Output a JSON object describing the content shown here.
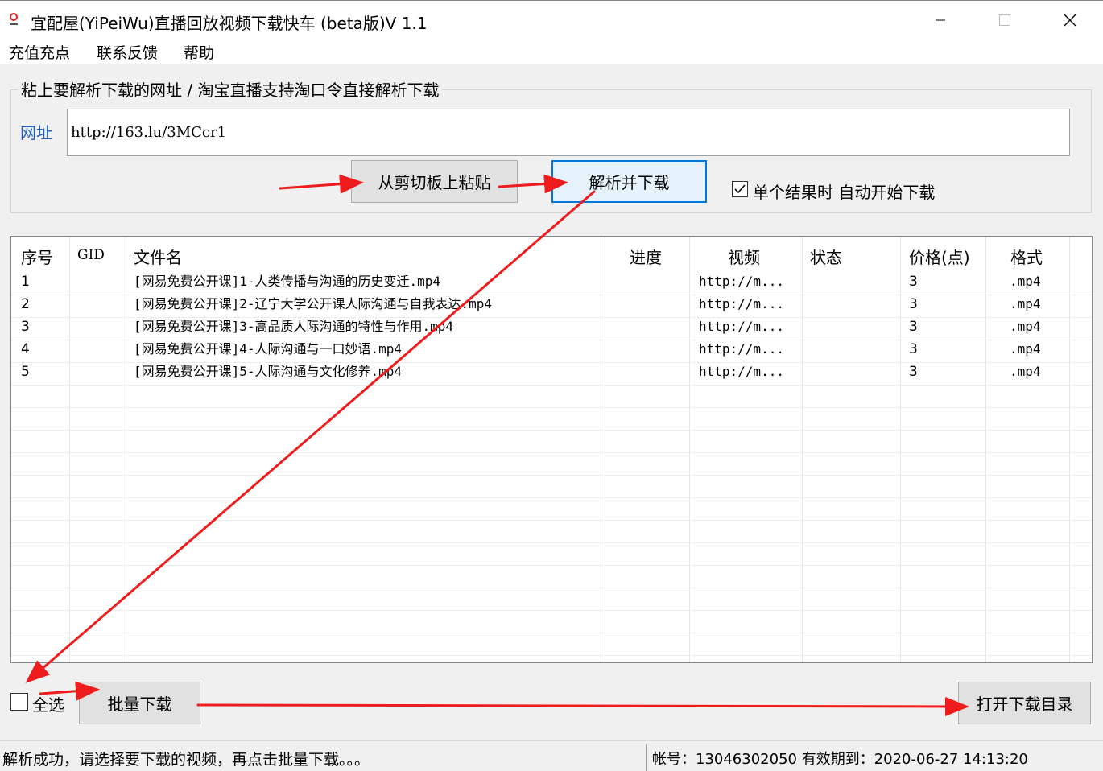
{
  "window": {
    "title": "宜配屋(YiPeiWu)直播回放视频下载快车 (beta版)V 1.1",
    "minimize_icon": "minimize-icon",
    "maximize_icon": "maximize-icon",
    "close_icon": "close-icon"
  },
  "menu": {
    "items": [
      "充值充点",
      "联系反馈",
      "帮助"
    ]
  },
  "input_group": {
    "legend": "粘上要解析下载的网址 / 淘宝直播支持淘口令直接解析下载",
    "url_label": "网址",
    "url_value": "http://163.lu/3MCcr1",
    "paste_button": "从剪切板上粘贴",
    "parse_button": "解析并下载",
    "auto_download_label": "单个结果时 自动开始下载",
    "auto_download_checked": true
  },
  "table": {
    "headers": [
      "序号",
      "GID",
      "文件名",
      "进度",
      "视频",
      "状态",
      "价格(点)",
      "格式"
    ],
    "rows": [
      {
        "index": "1",
        "gid": "",
        "filename": "[网易免费公开课]1-人类传播与沟通的历史变迁.mp4",
        "progress": "",
        "video": "http://m...",
        "status": "",
        "price": "3",
        "format": ".mp4"
      },
      {
        "index": "2",
        "gid": "",
        "filename": "[网易免费公开课]2-辽宁大学公开课人际沟通与自我表达.mp4",
        "progress": "",
        "video": "http://m...",
        "status": "",
        "price": "3",
        "format": ".mp4"
      },
      {
        "index": "3",
        "gid": "",
        "filename": "[网易免费公开课]3-高品质人际沟通的特性与作用.mp4",
        "progress": "",
        "video": "http://m...",
        "status": "",
        "price": "3",
        "format": ".mp4"
      },
      {
        "index": "4",
        "gid": "",
        "filename": "[网易免费公开课]4-人际沟通与一口妙语.mp4",
        "progress": "",
        "video": "http://m...",
        "status": "",
        "price": "3",
        "format": ".mp4"
      },
      {
        "index": "5",
        "gid": "",
        "filename": "[网易免费公开课]5-人际沟通与文化修养.mp4",
        "progress": "",
        "video": "http://m...",
        "status": "",
        "price": "3",
        "format": ".mp4"
      }
    ]
  },
  "bottom": {
    "select_all_label": "全选",
    "select_all_checked": false,
    "batch_download_button": "批量下载",
    "open_folder_button": "打开下载目录"
  },
  "status": {
    "message": "解析成功，请选择要下载的视频，再点击批量下载。。。",
    "account": "帐号：13046302050 有效期到：2020-06-27 14:13:20"
  },
  "colors": {
    "arrow": "#ee1c1c",
    "link_blue": "#1e5fc6",
    "focus_blue": "#0078d7"
  }
}
